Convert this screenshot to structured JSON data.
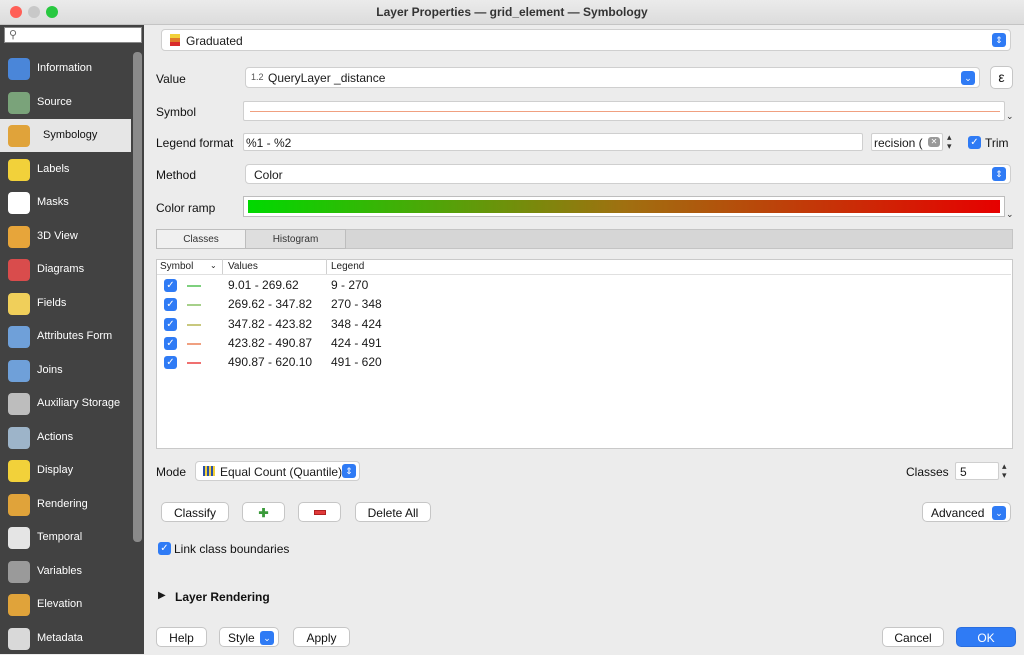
{
  "window": {
    "title": "Layer Properties — grid_element — Symbology"
  },
  "sidebar": {
    "search_placeholder": "",
    "items": [
      {
        "label": "Information",
        "icon": "info-icon",
        "color": "#4a86d9",
        "active": false
      },
      {
        "label": "Source",
        "icon": "source-wrench-icon",
        "color": "#7aa37a",
        "active": false
      },
      {
        "label": "Symbology",
        "icon": "paintbrush-icon",
        "color": "#e0a33a",
        "active": true
      },
      {
        "label": "Labels",
        "icon": "abc-label-icon",
        "color": "#f2d13a",
        "active": false
      },
      {
        "label": "Masks",
        "icon": "abc-mask-icon",
        "color": "#ffffff",
        "active": false
      },
      {
        "label": "3D View",
        "icon": "cube-3d-icon",
        "color": "#e7a53a",
        "active": false
      },
      {
        "label": "Diagrams",
        "icon": "diagram-icon",
        "color": "#d94c4c",
        "active": false
      },
      {
        "label": "Fields",
        "icon": "fields-icon",
        "color": "#f0cf5a",
        "active": false
      },
      {
        "label": "Attributes Form",
        "icon": "form-icon",
        "color": "#6fa0d9",
        "active": false
      },
      {
        "label": "Joins",
        "icon": "join-icon",
        "color": "#6fa0d9",
        "active": false
      },
      {
        "label": "Auxiliary Storage",
        "icon": "database-icon",
        "color": "#bdbdbd",
        "active": false
      },
      {
        "label": "Actions",
        "icon": "gear-play-icon",
        "color": "#9db4c9",
        "active": false
      },
      {
        "label": "Display",
        "icon": "speech-bubble-icon",
        "color": "#f2d13a",
        "active": false
      },
      {
        "label": "Rendering",
        "icon": "brush-icon",
        "color": "#e0a33a",
        "active": false
      },
      {
        "label": "Temporal",
        "icon": "clock-icon",
        "color": "#e5e5e5",
        "active": false
      },
      {
        "label": "Variables",
        "icon": "epsilon-icon",
        "color": "#9a9a9a",
        "active": false
      },
      {
        "label": "Elevation",
        "icon": "elevation-icon",
        "color": "#e0a33a",
        "active": false
      },
      {
        "label": "Metadata",
        "icon": "metadata-icon",
        "color": "#d9d9d9",
        "active": false
      }
    ]
  },
  "renderer": {
    "type_label": "Graduated"
  },
  "value": {
    "label": "Value",
    "type_badge": "1.2",
    "field": "QueryLayer _distance",
    "expr_icon": "ε"
  },
  "symbol": {
    "label": "Symbol",
    "line_color": "#f0a080"
  },
  "legend_format": {
    "label": "Legend format",
    "value": "%1 - %2",
    "precision_label": "recision (",
    "trim_label": "Trim"
  },
  "method": {
    "label": "Method",
    "value": "Color"
  },
  "color_ramp": {
    "label": "Color ramp",
    "start": "#00d900",
    "mid": "#a07010",
    "end": "#e60000"
  },
  "tabs": [
    "Classes",
    "Histogram"
  ],
  "table": {
    "headers": [
      "Symbol",
      "Values",
      "Legend"
    ],
    "rows": [
      {
        "values": "9.01 - 269.62",
        "legend": "9 - 270",
        "color": "#7ed07e"
      },
      {
        "values": "269.62 - 347.82",
        "legend": "270 - 348",
        "color": "#a6d08a"
      },
      {
        "values": "347.82 - 423.82",
        "legend": "348 - 424",
        "color": "#c8c87e"
      },
      {
        "values": "423.82 - 490.87",
        "legend": "424 - 491",
        "color": "#f0a080"
      },
      {
        "values": "490.87 - 620.10",
        "legend": "491 - 620",
        "color": "#f07070"
      }
    ]
  },
  "mode": {
    "label": "Mode",
    "value": "Equal Count (Quantile)",
    "classes_label": "Classes",
    "classes_value": "5"
  },
  "buttons": {
    "classify": "Classify",
    "add_class_icon": "plus-icon",
    "remove_class_icon": "minus-icon",
    "delete_all": "Delete All",
    "advanced": "Advanced"
  },
  "link_boundaries": "Link class boundaries",
  "layer_rendering": "Layer Rendering",
  "footer": {
    "help": "Help",
    "style": "Style",
    "apply": "Apply",
    "cancel": "Cancel",
    "ok": "OK"
  },
  "colors": {
    "accent": "#2f7bf5"
  }
}
